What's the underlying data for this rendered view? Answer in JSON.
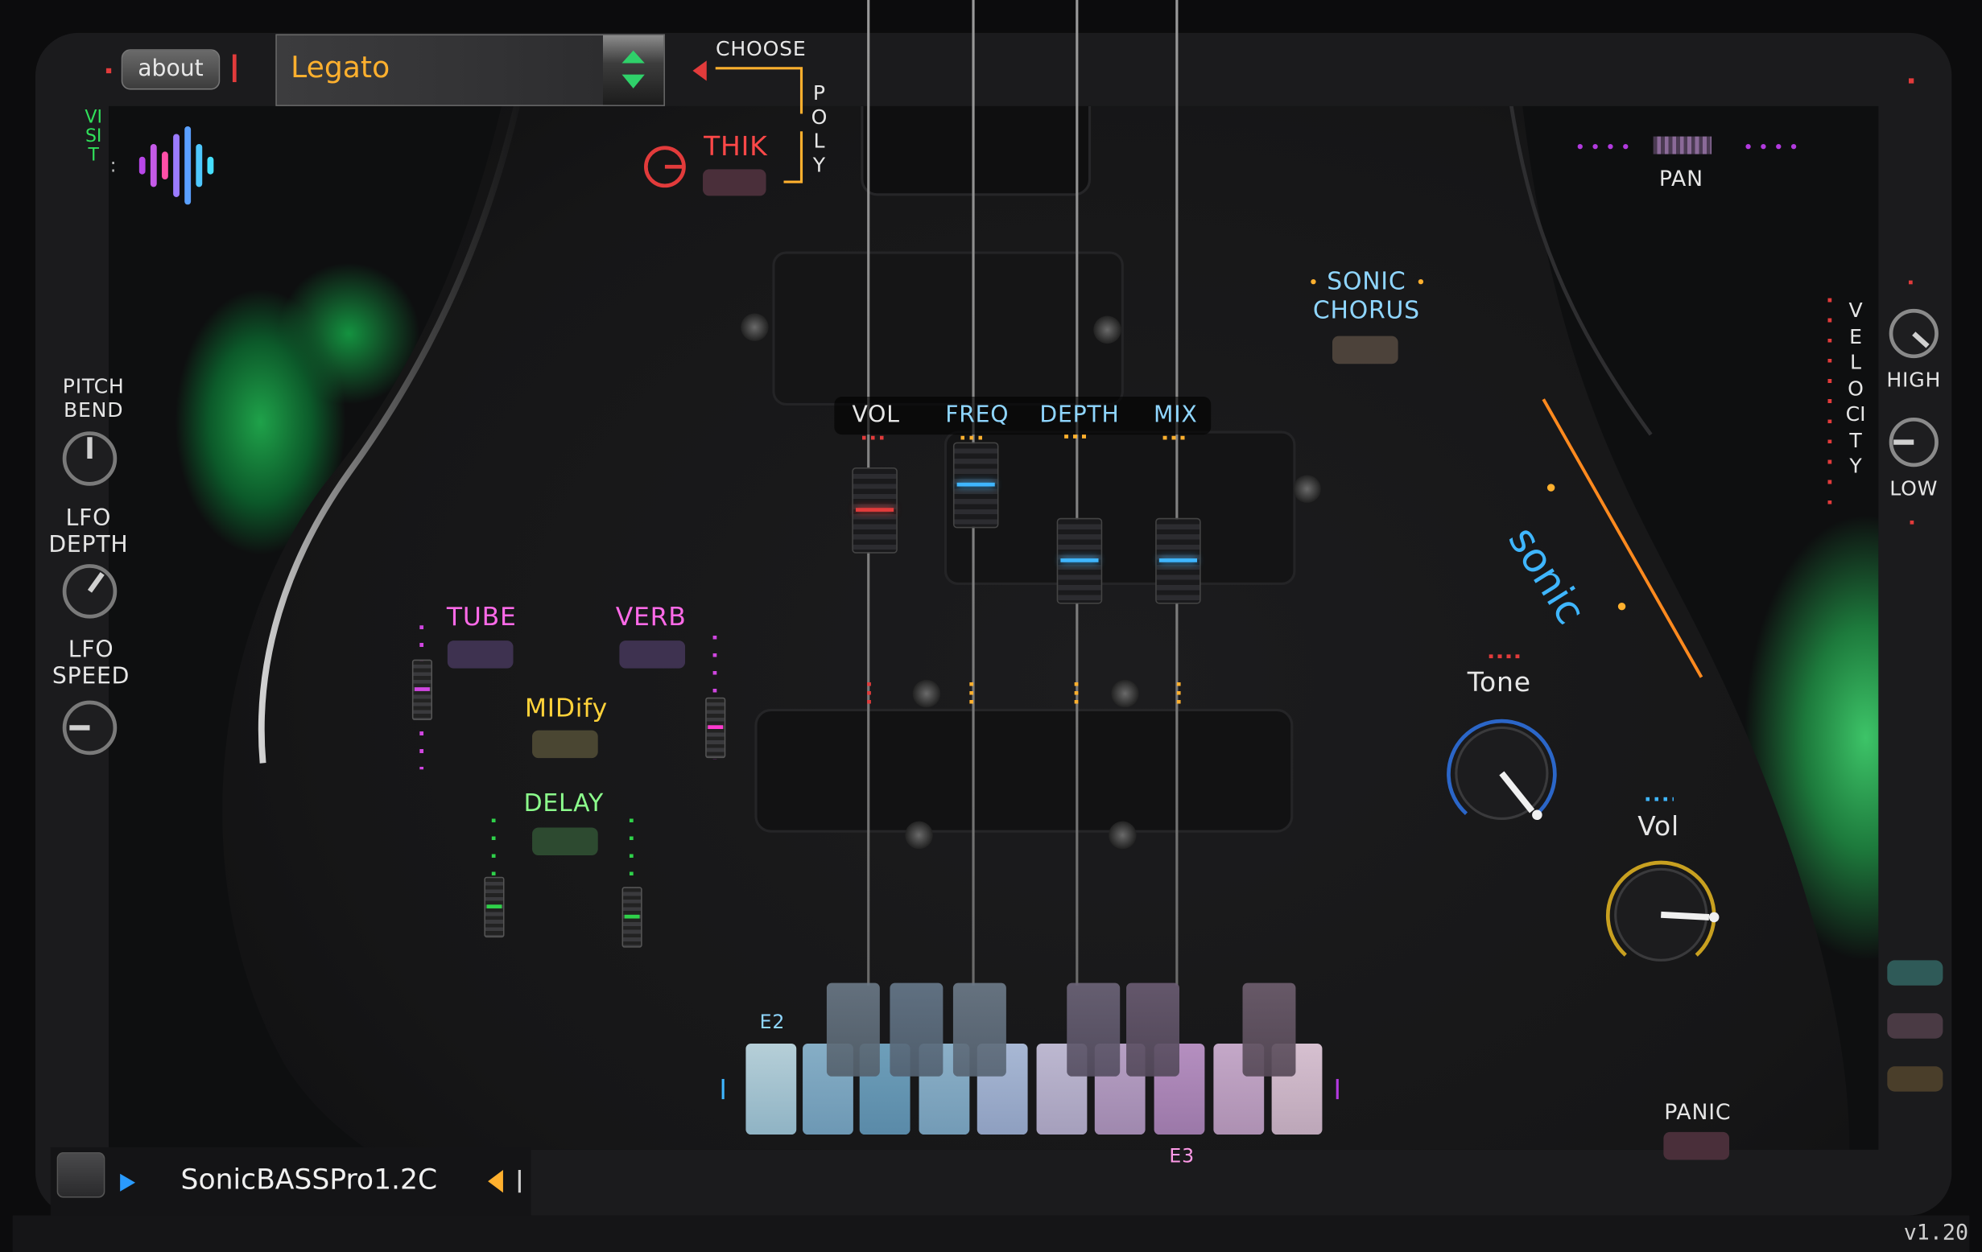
{
  "header": {
    "about_label": "about",
    "preset_mode": "Legato",
    "choose_label": "CHOOSE",
    "poly_label": "POLY",
    "thik_label": "THIK"
  },
  "visit_label": "VISIT",
  "left_panel": {
    "pitch_bend": "PITCH BEND",
    "lfo_depth": "LFO DEPTH",
    "lfo_speed": "LFO SPEED"
  },
  "right_panel": {
    "pan_label": "PAN",
    "velocity_label": "VELOCITY",
    "high_label": "HIGH",
    "low_label": "LOW",
    "panic_label": "PANIC"
  },
  "effects": {
    "sonic_chorus": "SONIC CHORUS",
    "tube": "TUBE",
    "verb": "VERB",
    "midify": "MIDify",
    "delay": "DELAY"
  },
  "faders": [
    {
      "label": "VOL",
      "color": "#e23b3b",
      "label_color": "#ffffff"
    },
    {
      "label": "FREQ",
      "color": "#3fb6ff",
      "label_color": "#8fd6ff"
    },
    {
      "label": "DEPTH",
      "color": "#3fb6ff",
      "label_color": "#8fd6ff"
    },
    {
      "label": "MIX",
      "color": "#3fb6ff",
      "label_color": "#8fd6ff"
    }
  ],
  "knobs": {
    "tone_label": "Tone",
    "vol_label": "Vol"
  },
  "brand": "sonic",
  "keyboard": {
    "low_note": "E2",
    "high_note": "E3"
  },
  "footer": {
    "preset_name": "SonicBASSPro1.2C",
    "version": "v1.20"
  },
  "colors": {
    "accent_red": "#e23b3b",
    "accent_blue": "#3fb6ff",
    "accent_orange": "#ff8a1f",
    "accent_magenta": "#d046e0",
    "accent_green": "#2fd14a",
    "label_yellow": "#ffd23a"
  }
}
